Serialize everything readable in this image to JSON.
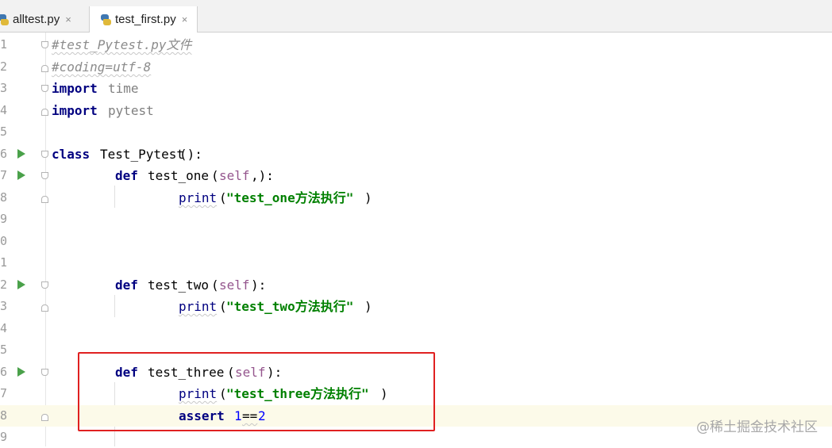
{
  "tabs": [
    {
      "label": "alltest.py",
      "active": false,
      "icon": "python-file-icon"
    },
    {
      "label": "test_first.py",
      "active": true,
      "icon": "python-file-icon"
    }
  ],
  "tab_close_glyph": "×",
  "line_numbers": [
    "1",
    "2",
    "3",
    "4",
    "5",
    "6",
    "7",
    "8",
    "9",
    "0",
    "1",
    "2",
    "3",
    "4",
    "5",
    "6",
    "7",
    "8",
    "9"
  ],
  "code": {
    "l1": "#test_Pytest.py文件",
    "l2": "#coding=utf-8",
    "l3_kw": "import",
    "l3_mod": "time",
    "l4_kw": "import",
    "l4_mod": "pytest",
    "l6_kw": "class",
    "l6_name": "Test_Pytest",
    "l7_kw": "def",
    "l7_name": "test_one",
    "l7_self": "self",
    "l8_print": "print",
    "l8_str": "\"test_one方法执行\"",
    "l12_kw": "def",
    "l12_name": "test_two",
    "l12_self": "self",
    "l13_print": "print",
    "l13_str": "\"test_two方法执行\"",
    "l16_kw": "def",
    "l16_name": "test_three",
    "l16_self": "self",
    "l17_print": "print",
    "l17_str": "\"test_three方法执行\"",
    "l18_kw": "assert",
    "l18_expr_a": "1",
    "l18_op": "==",
    "l18_expr_b": "2"
  },
  "watermark": "@稀土掘金技术社区",
  "colors": {
    "highlight_box": "#e02020",
    "run_icon": "#4aa14a",
    "current_line": "#fcfae9"
  }
}
